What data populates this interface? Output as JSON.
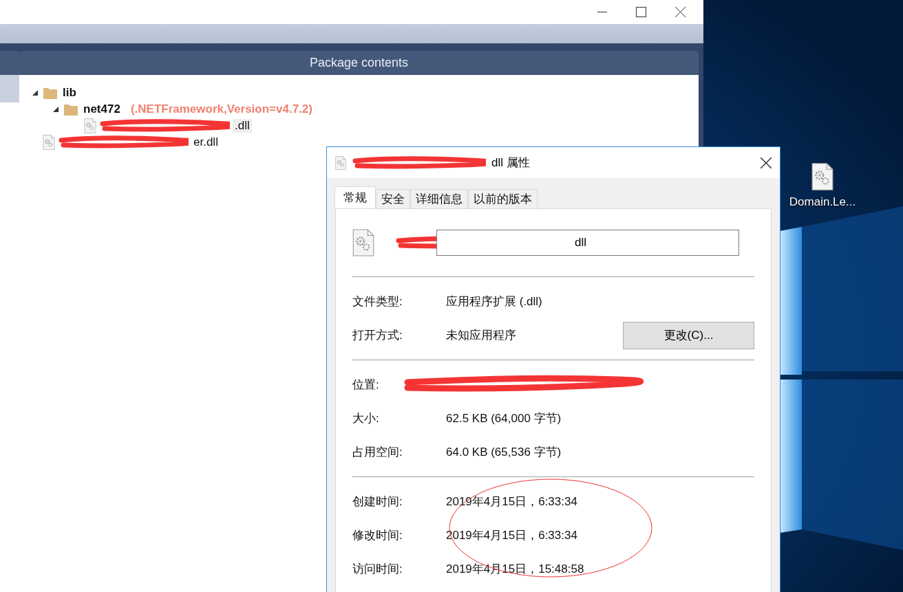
{
  "package_window": {
    "panel": {
      "title": "Package contents",
      "tree": [
        {
          "label": "lib",
          "kind": "folder",
          "expanded": true,
          "children": [
            {
              "label": "net472",
              "note": "(.NETFramework,Version=v4.7.2)",
              "kind": "folder",
              "expanded": true,
              "children": [
                {
                  "label": ".dll",
                  "kind": "file",
                  "selected": true
                }
              ]
            }
          ]
        },
        {
          "label": "er.dll",
          "kind": "file",
          "selected": false
        }
      ]
    }
  },
  "properties_dialog": {
    "title": "dll 属性",
    "tabs": [
      {
        "label": "常规",
        "selected": true
      },
      {
        "label": "安全",
        "selected": false
      },
      {
        "label": "详细信息",
        "selected": false
      },
      {
        "label": "以前的版本",
        "selected": false
      }
    ],
    "file_name": "dll",
    "sections": [
      [
        {
          "label": "文件类型:",
          "value": "应用程序扩展 (.dll)"
        },
        {
          "label": "打开方式:",
          "value": "未知应用程序",
          "button": "更改(C)..."
        }
      ],
      [
        {
          "label": "位置:"
        },
        {
          "label": "大小:",
          "value": "62.5 KB (64,000 字节)"
        },
        {
          "label": "占用空间:",
          "value": "64.0 KB (65,536 字节)"
        }
      ],
      [
        {
          "label": "创建时间:",
          "value": "2019年4月15日，6:33:34"
        },
        {
          "label": "修改时间:",
          "value": "2019年4月15日，6:33:34"
        },
        {
          "label": "访问时间:",
          "value": "2019年4月15日，15:48:58"
        }
      ]
    ]
  },
  "desktop": {
    "icons": [
      {
        "label": "Domain.Le..."
      }
    ]
  }
}
